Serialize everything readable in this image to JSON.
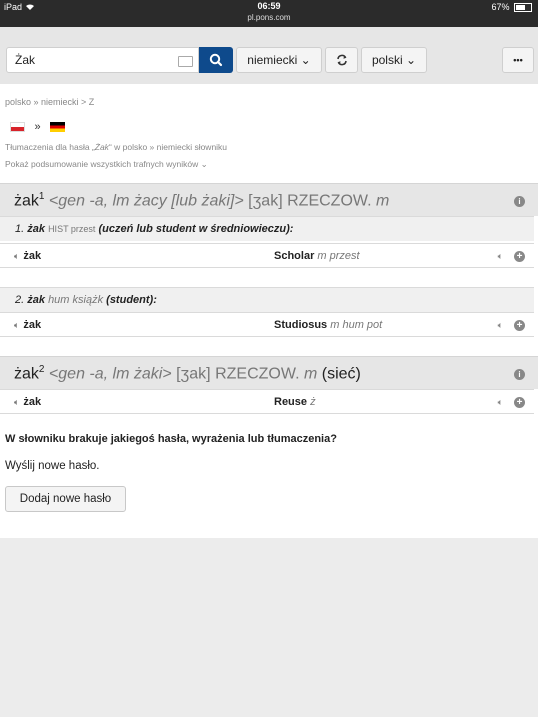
{
  "status": {
    "device": "iPad",
    "time": "06:59",
    "url": "pl.pons.com",
    "battery": "67%",
    "battery_level": 0.67
  },
  "search": {
    "value": "Żak"
  },
  "toolbar": {
    "source_lang": "niemiecki",
    "target_lang": "polski",
    "more": "•••"
  },
  "breadcrumb": "polsko » niemiecki > Z",
  "translations_line": {
    "prefix": "Tłumaczenia dla hasła „",
    "term": "Żak",
    "suffix": "“ w polsko » niemiecki słowniku"
  },
  "summary_link": "Pokaż podsumowanie wszystkich trafnych wyników",
  "entries": [
    {
      "headword": "żak",
      "sup": "1",
      "grammar": "<gen -a, lm żacy [lub żaki]>",
      "phonetic": "[ʒak]",
      "pos": "RZECZOW.",
      "gender": "m",
      "extra": "",
      "senses": [
        {
          "num": "1.",
          "word": "żak",
          "labels": "HIST przest",
          "gloss": "(uczeń lub student w średniowieczu):",
          "rows": [
            {
              "source": "żak",
              "target": "Scholar",
              "target_info": "m przest"
            }
          ]
        },
        {
          "num": "2.",
          "word": "żak",
          "labels": "hum książk",
          "gloss": "(student):",
          "rows": [
            {
              "source": "żak",
              "target": "Studiosus",
              "target_info": "m hum pot"
            }
          ]
        }
      ]
    },
    {
      "headword": "żak",
      "sup": "2",
      "grammar": "<gen -a, lm żaki>",
      "phonetic": "[ʒak]",
      "pos": "RZECZOW.",
      "gender": "m",
      "extra": "(sieć)",
      "rows": [
        {
          "source": "żak",
          "target": "Reuse",
          "target_info": "ż"
        }
      ]
    }
  ],
  "missing_prompt": "W słowniku brakuje jakiegoś hasła, wyrażenia lub tłumaczenia?",
  "send_text": "Wyślij nowe hasło.",
  "add_button": "Dodaj nowe hasło"
}
